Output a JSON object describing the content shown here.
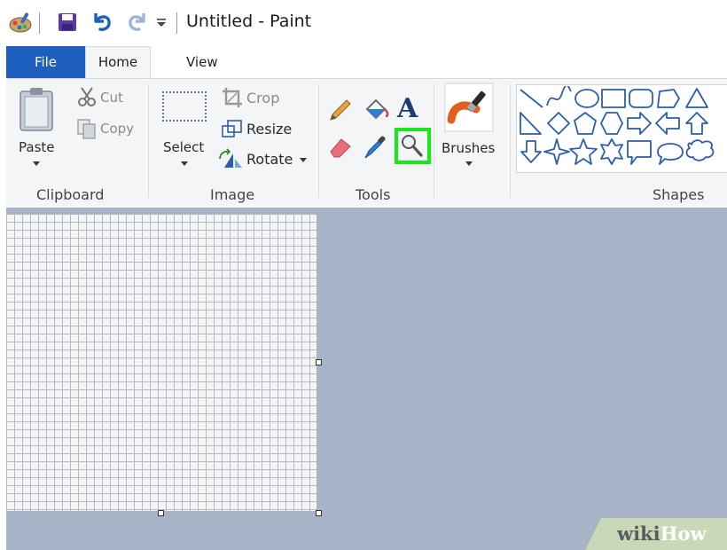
{
  "window": {
    "title": "Untitled - Paint"
  },
  "tabs": [
    {
      "label": "File"
    },
    {
      "label": "Home"
    },
    {
      "label": "View"
    }
  ],
  "ribbon": {
    "clipboard": {
      "paste_label": "Paste",
      "cut_label": "Cut",
      "copy_label": "Copy",
      "group_label": "Clipboard"
    },
    "image": {
      "select_label": "Select",
      "crop_label": "Crop",
      "resize_label": "Resize",
      "rotate_label": "Rotate",
      "group_label": "Image"
    },
    "tools": {
      "group_label": "Tools",
      "items": [
        "pencil-icon",
        "fill-bucket-icon",
        "text-icon",
        "eraser-icon",
        "color-picker-icon",
        "magnifier-icon"
      ],
      "highlight_color": "#19e819"
    },
    "brushes": {
      "label": "Brushes"
    },
    "shapes": {
      "group_label": "Shapes"
    }
  },
  "watermark": {
    "text_a": "wiki",
    "text_b": "How"
  },
  "colors": {
    "accent": "#1d5fbe",
    "workspace": "#a7b3c6",
    "ribbon": "#f4f5f7"
  }
}
